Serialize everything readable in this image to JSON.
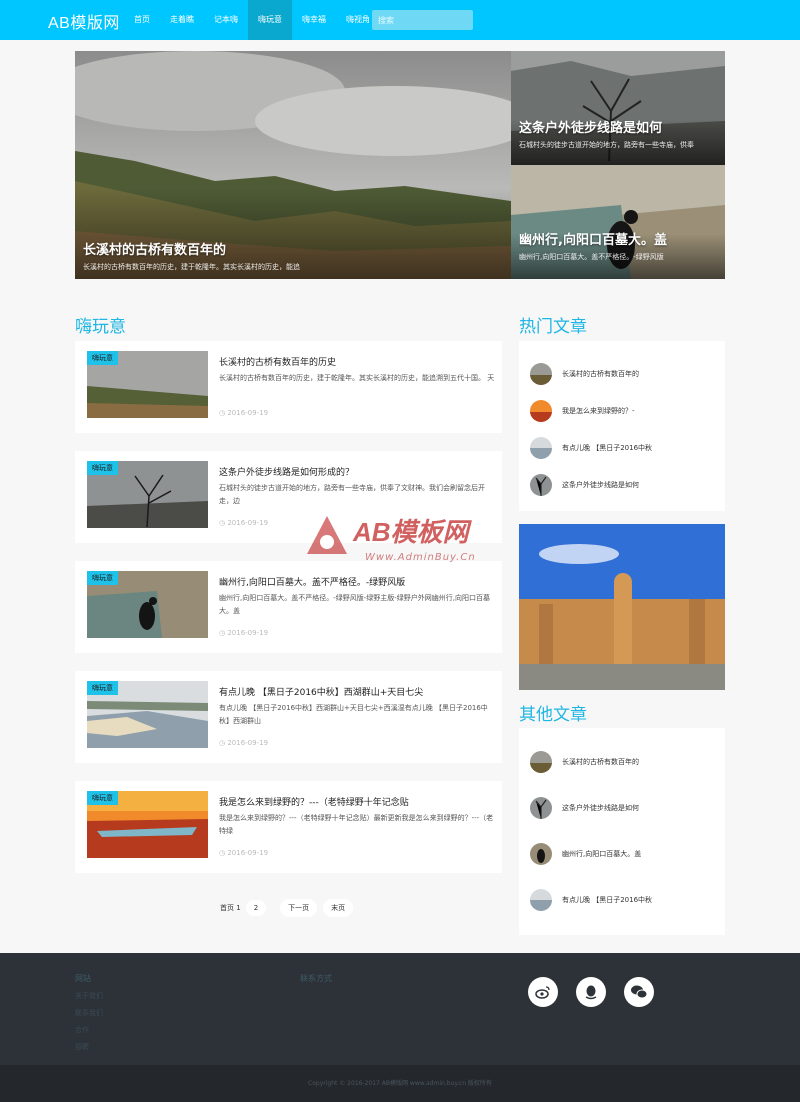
{
  "header": {
    "logo": "AB模版网",
    "nav": [
      "首页",
      "走着瞧",
      "记本嗨",
      "嗨玩意",
      "嗨幸福",
      "嗨视角"
    ],
    "active_nav": "嗨玩意",
    "search_placeholder": "搜索",
    "colors": {
      "bar": "#00c6ff",
      "active": "#0aa8cf"
    }
  },
  "banner": {
    "main": {
      "title": "长溪村的古桥有数百年的",
      "desc": "长溪村的古桥有数百年的历史，建于乾隆年。其实长溪村的历史，能追"
    },
    "side1": {
      "title": "这条户外徒步线路是如何",
      "desc": "石城村头的徒步古道开始的地方，路旁有一些寺庙，供奉"
    },
    "side2": {
      "title": "幽州行,向阳口百墓大。盖",
      "desc": "幽州行,向阳口百墓大。盖不严格径。-绿野风版"
    }
  },
  "section": {
    "title": "嗨玩意"
  },
  "articles": [
    {
      "tag": "嗨玩意",
      "title": "长溪村的古桥有数百年的历史",
      "desc": "长溪村的古桥有数百年的历史，建于乾隆年。其实长溪村的历史，能追溯到五代十国。        天",
      "date": "2016-09-19"
    },
    {
      "tag": "嗨玩意",
      "title": "这条户外徒步线路是如何形成的？",
      "desc": "石城村头的徒步古道开始的地方，路旁有一些寺庙，供奉了文财神。我们会刷留念后开走，边",
      "date": "2016-09-19"
    },
    {
      "tag": "嗨玩意",
      "title": "幽州行,向阳口百墓大。盖不严格径。-绿野风版",
      "desc": "幽州行,向阳口百墓大。盖不严格径。-绿野风版-绿野主版-绿野户外网幽州行,向阳口百墓大。盖",
      "date": "2016-09-19"
    },
    {
      "tag": "嗨玩意",
      "title": "有点儿晚 【黑日子2016中秋】西湖群山+天目七尖",
      "desc": "有点儿晚 【黑日子2016中秋】西湖群山+天目七尖+西溪湿有点儿晚 【黑日子2016中秋】西湖群山",
      "date": "2016-09-19"
    },
    {
      "tag": "嗨玩意",
      "title": "我是怎么来到绿野的？---（老特绿野十年记念贴",
      "desc": "我是怎么来到绿野的？---（老特绿野十年记念贴）最新更新我是怎么来到绿野的？---（老特绿",
      "date": "2016-09-19"
    }
  ],
  "pagination": {
    "label": "首页 1",
    "current": "2",
    "next": "下一页",
    "last": "末页"
  },
  "hot": {
    "title": "热门文章",
    "items": [
      "长溪村的古桥有数百年的",
      "我是怎么来到绿野的？-",
      "有点儿晚 【黑日子2016中秋",
      "这条户外徒步线路是如何"
    ]
  },
  "other": {
    "title": "其他文章",
    "items": [
      "长溪村的古桥有数百年的",
      "这条户外徒步线路是如何",
      "幽州行,向阳口百墓大。盖",
      "有点儿晚 【黑日子2016中秋"
    ]
  },
  "footer": {
    "col1": {
      "heading": "网站",
      "links": [
        "关于我们",
        "联系我们",
        "合作",
        "招聘"
      ]
    },
    "col2": {
      "heading": "联系方式"
    },
    "social": [
      "weibo-icon",
      "qq-icon",
      "wechat-icon"
    ],
    "copyright": "Copyright © 2016-2017 AB模版网 www.admin.buy.cn 版权所有"
  },
  "watermark": {
    "main": "AB模板网",
    "sub": "Www.AdminBuy.Cn"
  }
}
